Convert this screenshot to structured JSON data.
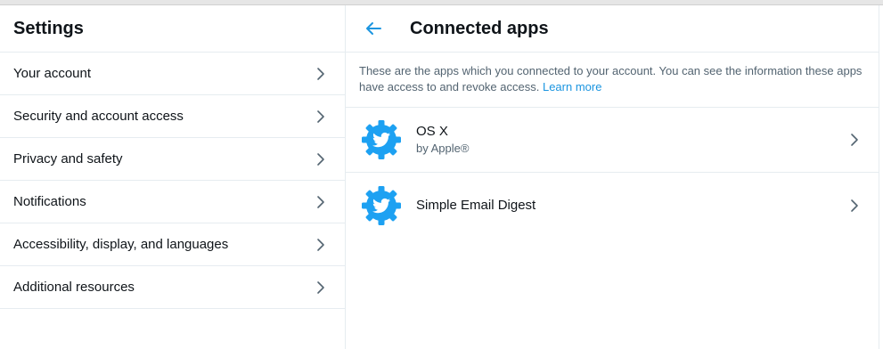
{
  "settings": {
    "title": "Settings",
    "items": [
      {
        "label": "Your account"
      },
      {
        "label": "Security and account access"
      },
      {
        "label": "Privacy and safety"
      },
      {
        "label": "Notifications"
      },
      {
        "label": "Accessibility, display, and languages"
      },
      {
        "label": "Additional resources"
      }
    ]
  },
  "connected_apps": {
    "title": "Connected apps",
    "description": "These are the apps which you connected to your account. You can see the information these apps have access to and revoke access.",
    "learn_more": "Learn more",
    "apps": [
      {
        "name": "OS X",
        "by": "by Apple®",
        "icon": "twitter-gear-icon"
      },
      {
        "name": "Simple Email Digest",
        "by": "",
        "icon": "twitter-gear-icon"
      }
    ]
  },
  "icons": {
    "back": "arrow-left-icon",
    "chevron": "chevron-right-icon"
  },
  "colors": {
    "accent": "#1b95e0",
    "app_icon": "#1da1f2",
    "divider": "#e6ecf0",
    "text_primary": "#0f1419",
    "text_secondary": "#536471"
  }
}
